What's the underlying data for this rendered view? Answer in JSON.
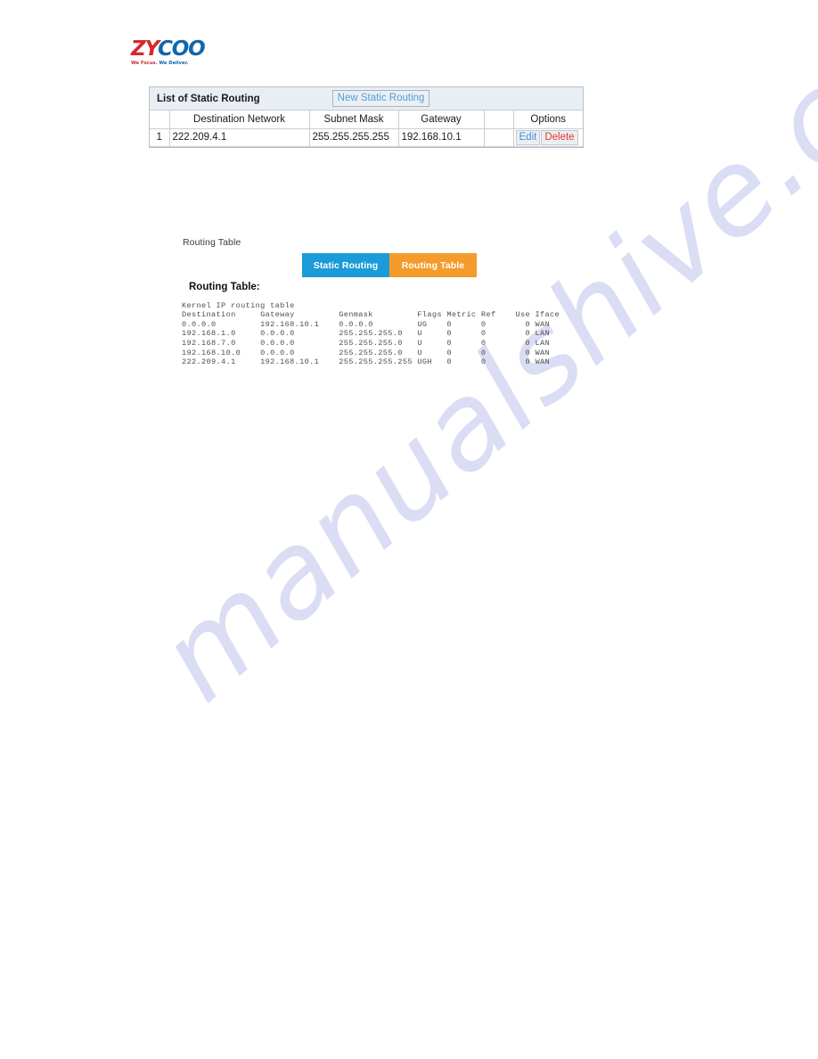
{
  "logo": {
    "mark_primary": "ZY",
    "mark_secondary": "COO",
    "tagline_part1": "We Focus.",
    "tagline_part2": " We Deliver.",
    "color_red": "#d7262b",
    "color_blue": "#1265ad"
  },
  "watermark": {
    "text": "manualshive.com",
    "color": "#cdd0ef"
  },
  "static_routing": {
    "panel_title": "List of Static Routing",
    "new_button_label": "New Static Routing",
    "columns": [
      "",
      "Destination Network",
      "Subnet Mask",
      "Gateway",
      "",
      "Options"
    ],
    "rows": [
      {
        "index": "1",
        "destination_network": "222.209.4.1",
        "subnet_mask": "255.255.255.255",
        "gateway": "192.168.10.1",
        "edit_label": "Edit",
        "delete_label": "Delete",
        "edit_color": "#3d8fd8",
        "delete_color": "#e8352e"
      }
    ]
  },
  "routing_section": {
    "caption": "Routing Table",
    "tabs": [
      {
        "label": "Static Routing",
        "color": "#1b9bd8",
        "active": false
      },
      {
        "label": "Routing Table",
        "color": "#f59b2c",
        "active": true
      }
    ],
    "output_heading": "Routing Table:",
    "output_subtitle": "Kernel IP routing table",
    "output_columns": [
      "Destination",
      "Gateway",
      "Genmask",
      "Flags",
      "Metric",
      "Ref",
      "Use",
      "Iface"
    ],
    "output_rows": [
      {
        "destination": "0.0.0.0",
        "gateway": "192.168.10.1",
        "genmask": "0.0.0.0",
        "flags": "UG",
        "metric": "0",
        "ref": "0",
        "use": "0",
        "iface": "WAN"
      },
      {
        "destination": "192.168.1.0",
        "gateway": "0.0.0.0",
        "genmask": "255.255.255.0",
        "flags": "U",
        "metric": "0",
        "ref": "0",
        "use": "0",
        "iface": "LAN"
      },
      {
        "destination": "192.168.7.0",
        "gateway": "0.0.0.0",
        "genmask": "255.255.255.0",
        "flags": "U",
        "metric": "0",
        "ref": "0",
        "use": "0",
        "iface": "LAN"
      },
      {
        "destination": "192.168.10.0",
        "gateway": "0.0.0.0",
        "genmask": "255.255.255.0",
        "flags": "U",
        "metric": "0",
        "ref": "0",
        "use": "0",
        "iface": "WAN"
      },
      {
        "destination": "222.209.4.1",
        "gateway": "192.168.10.1",
        "genmask": "255.255.255.255",
        "flags": "UGH",
        "metric": "0",
        "ref": "0",
        "use": "0",
        "iface": "WAN"
      }
    ],
    "output_text": "Kernel IP routing table\nDestination     Gateway         Genmask         Flags Metric Ref    Use Iface\n0.0.0.0         192.168.10.1    0.0.0.0         UG    0      0        0 WAN\n192.168.1.0     0.0.0.0         255.255.255.0   U     0      0        0 LAN\n192.168.7.0     0.0.0.0         255.255.255.0   U     0      0        0 LAN\n192.168.10.0    0.0.0.0         255.255.255.0   U     0      0        0 WAN\n222.209.4.1     192.168.10.1    255.255.255.255 UGH   0      0        0 WAN"
  }
}
